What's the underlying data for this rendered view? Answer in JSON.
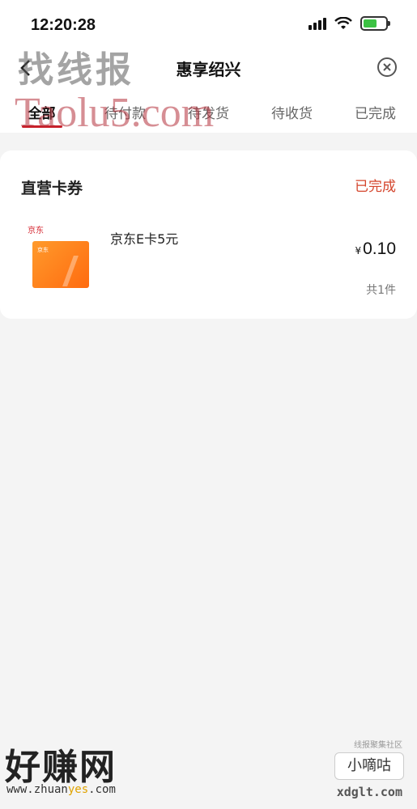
{
  "status_bar": {
    "time": "12:20:28"
  },
  "nav": {
    "title": "惠享绍兴"
  },
  "tabs": [
    {
      "label": "全部",
      "active": true
    },
    {
      "label": "待付款",
      "active": false
    },
    {
      "label": "待发货",
      "active": false
    },
    {
      "label": "待收货",
      "active": false
    },
    {
      "label": "已完成",
      "active": false
    }
  ],
  "order": {
    "shop_name": "直营卡券",
    "status": "已完成",
    "product": {
      "thumb_logo": "京东",
      "title": "京东E卡5元",
      "currency": "¥",
      "price": "0.10",
      "quantity": "共1件"
    }
  },
  "watermarks": {
    "top": "找线报",
    "taolu": "Taolu5.com",
    "bottom": "好赚网",
    "bottom_url_a": "www.zhuan",
    "bottom_url_b": "yes",
    "bottom_url_c": ".com",
    "right_tag": "线报聚集社区",
    "right_logo": "小嘀咕",
    "right_url": "xdglt.com"
  },
  "colors": {
    "accent_red": "#c8202a",
    "status_orange": "#d4452c",
    "card_orange": "#ff7a1a"
  }
}
